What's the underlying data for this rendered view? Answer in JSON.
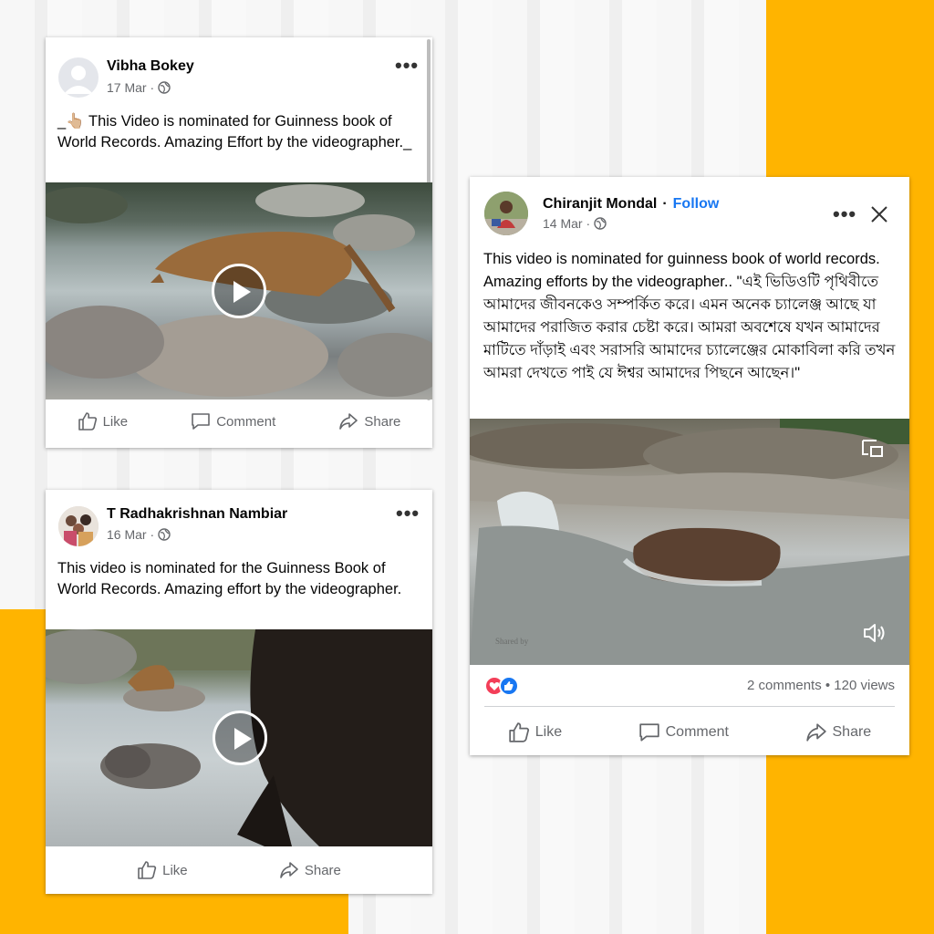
{
  "colors": {
    "accent": "#FFB400",
    "link": "#1877f2",
    "meta": "#65676b"
  },
  "post1": {
    "author": "Vibha Bokey",
    "date": "17 Mar ·",
    "privacy_icon": "globe-icon",
    "menu_icon": "more-options-icon",
    "text": "_👆🏼 This Video is nominated for Guinness book of World Records. Amazing Effort by the videographer._",
    "video_icon": "play-icon",
    "actions": {
      "like": "Like",
      "comment": "Comment",
      "share": "Share"
    }
  },
  "post2": {
    "author": "T Radhakrishnan Nambiar",
    "date": "16 Mar ·",
    "privacy_icon": "globe-icon",
    "menu_icon": "more-options-icon",
    "text": "This video is nominated for the Guinness Book of World Records. Amazing effort by the videographer.",
    "video_icon": "play-icon",
    "actions": {
      "like": "Like",
      "share": "Share"
    }
  },
  "post3": {
    "author": "Chiranjit Mondal",
    "separator": "·",
    "follow": "Follow",
    "date": "14 Mar ·",
    "privacy_icon": "globe-icon",
    "menu_icon": "more-options-icon",
    "close_icon": "close-icon",
    "text": "This video is nominated for guinness book of world records. Amazing efforts by the videographer..  \"এই ভিডিওটি পৃথিবীতে আমাদের জীবনকেও সম্পর্কিত করে। এমন অনেক চ্যালেঞ্জ আছে যা আমাদের পরাজিত করার চেষ্টা করে।  আমরা অবশেষে যখন আমাদের মাটিতে দাঁড়াই এবং সরাসরি আমাদের চ্যালেঞ্জের মোকাবিলা করি তখন আমরা দেখতে পাই যে ঈশ্বর আমাদের পিছনে আছেন।\"",
    "video_watermark": "Shared by",
    "reactions_icons": [
      "love-reaction-icon",
      "like-reaction-icon"
    ],
    "stats": "2 comments • 120 views",
    "actions": {
      "like": "Like",
      "comment": "Comment",
      "share": "Share"
    }
  }
}
